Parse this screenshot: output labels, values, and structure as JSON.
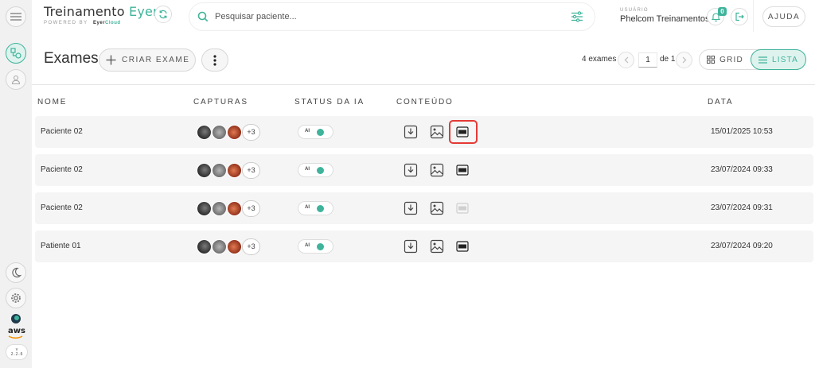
{
  "app": {
    "title_main": "Treinamento ",
    "title_accent": "Eyer",
    "powered_by": "POWERED BY",
    "powered_brand_1": "Eyer",
    "powered_brand_2": "Cloud"
  },
  "search": {
    "placeholder": "Pesquisar paciente..."
  },
  "user": {
    "label": "USUÁRIO",
    "name": "Phelcom Treinamentos",
    "notifications": "0"
  },
  "help_label": "AJUDA",
  "sidebar": {
    "version": [
      "v",
      "2.2.6"
    ],
    "aws_label": "aws"
  },
  "toolbar": {
    "page_title": "Exames",
    "create_label": "CRIAR EXAME",
    "exam_count": "4 exames",
    "page_current": "1",
    "page_of": "de 1",
    "view_grid": "GRID",
    "view_list": "LISTA"
  },
  "table": {
    "headers": {
      "name": "NOME",
      "captures": "CAPTURAS",
      "ai_status": "STATUS DA IA",
      "content": "CONTEÚDO",
      "date": "DATA"
    },
    "rows": [
      {
        "name": "Paciente 02",
        "more": "+3",
        "ai": "AI",
        "date": "15/01/2025 10:53",
        "pdf_available": true,
        "highlighted": true
      },
      {
        "name": "Paciente 02",
        "more": "+3",
        "ai": "AI",
        "date": "23/07/2024 09:33",
        "pdf_available": true,
        "highlighted": false
      },
      {
        "name": "Paciente 02",
        "more": "+3",
        "ai": "AI",
        "date": "23/07/2024 09:31",
        "pdf_available": false,
        "highlighted": false
      },
      {
        "name": "Patiente 01",
        "more": "+3",
        "ai": "AI",
        "date": "23/07/2024 09:20",
        "pdf_available": true,
        "highlighted": false
      }
    ]
  },
  "colors": {
    "accent": "#3fb39b",
    "highlight": "#e53935"
  },
  "icons": [
    "menu-icon",
    "exams-icon",
    "user-icon",
    "moon-icon",
    "gear-icon",
    "eyer-logo-icon",
    "refresh-icon",
    "search-icon",
    "filter-icon",
    "bell-icon",
    "logout-icon",
    "plus-icon",
    "kebab-icon",
    "chevron-left-icon",
    "chevron-right-icon",
    "grid-icon",
    "list-icon",
    "download-icon",
    "image-icon",
    "pdf-icon"
  ]
}
